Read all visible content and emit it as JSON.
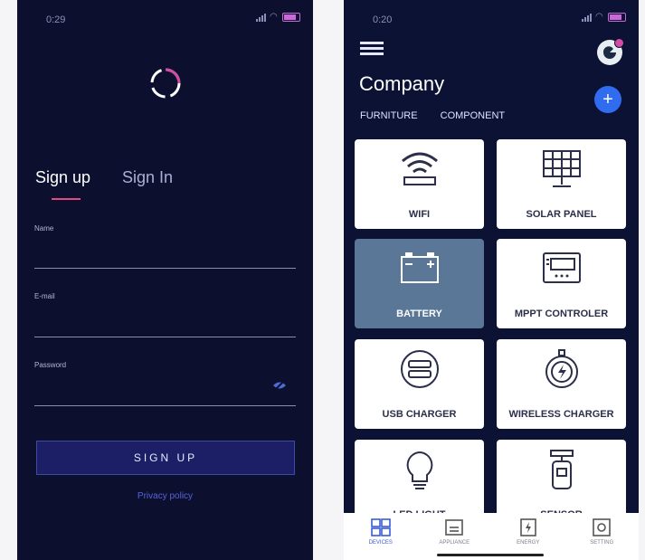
{
  "left": {
    "status_time": "0:29",
    "tabs": {
      "signup": "Sign up",
      "signin": "Sign In"
    },
    "fields": {
      "name_label": "Name",
      "email_label": "E-mail",
      "password_label": "Password"
    },
    "signup_button": "SIGN UP",
    "privacy_link": "Privacy policy"
  },
  "right": {
    "status_time": "0:20",
    "title": "Company",
    "categories": [
      "FURNITURE",
      "COMPONENT"
    ],
    "cards": [
      {
        "label": "WIFI",
        "icon": "wifi-icon"
      },
      {
        "label": "SOLAR PANEL",
        "icon": "solar-panel-icon"
      },
      {
        "label": "BATTERY",
        "icon": "battery-icon",
        "active": true
      },
      {
        "label": "MPPT CONTROLER",
        "icon": "controller-icon"
      },
      {
        "label": "USB CHARGER",
        "icon": "usb-charger-icon"
      },
      {
        "label": "WIRELESS CHARGER",
        "icon": "wireless-charger-icon"
      },
      {
        "label": "LED LIGHT",
        "icon": "bulb-icon"
      },
      {
        "label": "SENSOR",
        "icon": "sensor-icon"
      }
    ],
    "nav": [
      {
        "label": "DEVICES",
        "icon": "grid-icon",
        "active": true
      },
      {
        "label": "APPLIANCE",
        "icon": "appliance-icon"
      },
      {
        "label": "ENERGY",
        "icon": "energy-icon"
      },
      {
        "label": "SETTING",
        "icon": "setting-icon"
      }
    ]
  },
  "colors": {
    "left_bg": "#0d0f2e",
    "right_bg": "#0b1233",
    "accent_pink": "#e24a82",
    "accent_blue": "#2f6cf0",
    "active_card": "#5a7797"
  }
}
